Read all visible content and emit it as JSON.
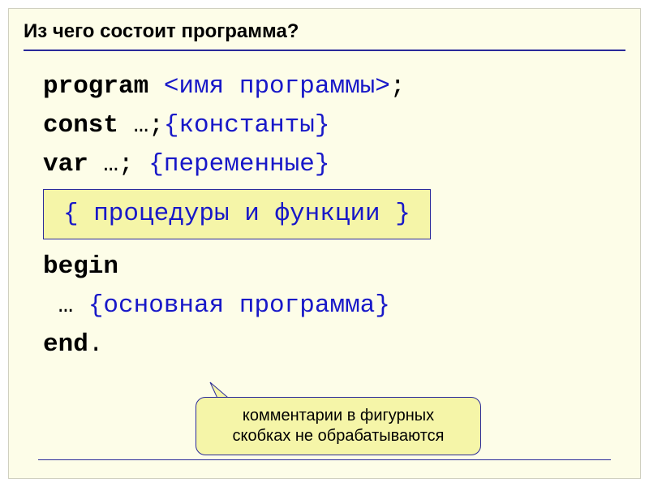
{
  "title": "Из чего состоит программа?",
  "code": {
    "l1_kw": "program ",
    "l1_placeholder": "<имя программы>",
    "l1_tail": ";",
    "l2_kw": "const ",
    "l2_tail": "…;",
    "l2_comment": "{константы}",
    "l3_kw": "var ",
    "l3_tail": "…; ",
    "l3_comment": "{переменные}",
    "procs_box": "{ процедуры и функции }",
    "l5_kw": "begin",
    "l6_pre": " … ",
    "l6_comment": "{основная программа}",
    "l7_kw": "end",
    "l7_tail": "."
  },
  "callout": {
    "line1": "комментарии в фигурных",
    "line2": "скобках не обрабатываются"
  }
}
